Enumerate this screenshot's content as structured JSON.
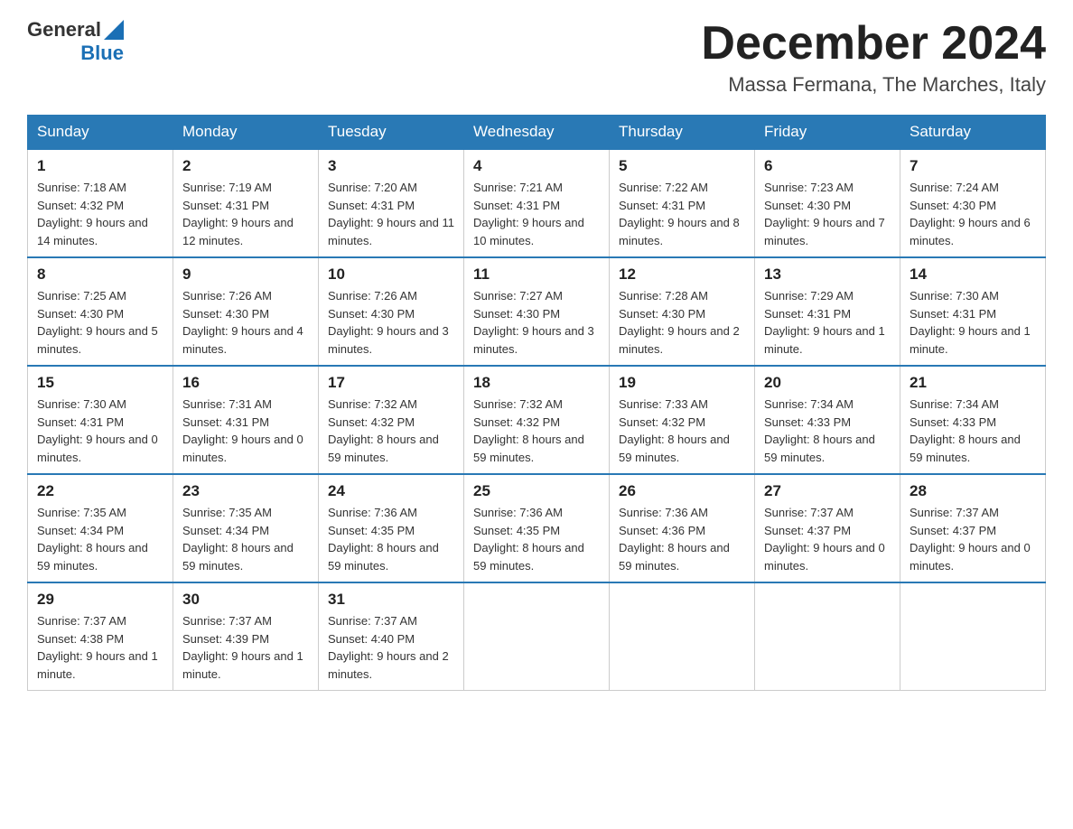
{
  "header": {
    "logo_general": "General",
    "logo_blue": "Blue",
    "title": "December 2024",
    "subtitle": "Massa Fermana, The Marches, Italy"
  },
  "calendar": {
    "days_of_week": [
      "Sunday",
      "Monday",
      "Tuesday",
      "Wednesday",
      "Thursday",
      "Friday",
      "Saturday"
    ],
    "weeks": [
      [
        {
          "day": "1",
          "sunrise": "7:18 AM",
          "sunset": "4:32 PM",
          "daylight": "9 hours and 14 minutes."
        },
        {
          "day": "2",
          "sunrise": "7:19 AM",
          "sunset": "4:31 PM",
          "daylight": "9 hours and 12 minutes."
        },
        {
          "day": "3",
          "sunrise": "7:20 AM",
          "sunset": "4:31 PM",
          "daylight": "9 hours and 11 minutes."
        },
        {
          "day": "4",
          "sunrise": "7:21 AM",
          "sunset": "4:31 PM",
          "daylight": "9 hours and 10 minutes."
        },
        {
          "day": "5",
          "sunrise": "7:22 AM",
          "sunset": "4:31 PM",
          "daylight": "9 hours and 8 minutes."
        },
        {
          "day": "6",
          "sunrise": "7:23 AM",
          "sunset": "4:30 PM",
          "daylight": "9 hours and 7 minutes."
        },
        {
          "day": "7",
          "sunrise": "7:24 AM",
          "sunset": "4:30 PM",
          "daylight": "9 hours and 6 minutes."
        }
      ],
      [
        {
          "day": "8",
          "sunrise": "7:25 AM",
          "sunset": "4:30 PM",
          "daylight": "9 hours and 5 minutes."
        },
        {
          "day": "9",
          "sunrise": "7:26 AM",
          "sunset": "4:30 PM",
          "daylight": "9 hours and 4 minutes."
        },
        {
          "day": "10",
          "sunrise": "7:26 AM",
          "sunset": "4:30 PM",
          "daylight": "9 hours and 3 minutes."
        },
        {
          "day": "11",
          "sunrise": "7:27 AM",
          "sunset": "4:30 PM",
          "daylight": "9 hours and 3 minutes."
        },
        {
          "day": "12",
          "sunrise": "7:28 AM",
          "sunset": "4:30 PM",
          "daylight": "9 hours and 2 minutes."
        },
        {
          "day": "13",
          "sunrise": "7:29 AM",
          "sunset": "4:31 PM",
          "daylight": "9 hours and 1 minute."
        },
        {
          "day": "14",
          "sunrise": "7:30 AM",
          "sunset": "4:31 PM",
          "daylight": "9 hours and 1 minute."
        }
      ],
      [
        {
          "day": "15",
          "sunrise": "7:30 AM",
          "sunset": "4:31 PM",
          "daylight": "9 hours and 0 minutes."
        },
        {
          "day": "16",
          "sunrise": "7:31 AM",
          "sunset": "4:31 PM",
          "daylight": "9 hours and 0 minutes."
        },
        {
          "day": "17",
          "sunrise": "7:32 AM",
          "sunset": "4:32 PM",
          "daylight": "8 hours and 59 minutes."
        },
        {
          "day": "18",
          "sunrise": "7:32 AM",
          "sunset": "4:32 PM",
          "daylight": "8 hours and 59 minutes."
        },
        {
          "day": "19",
          "sunrise": "7:33 AM",
          "sunset": "4:32 PM",
          "daylight": "8 hours and 59 minutes."
        },
        {
          "day": "20",
          "sunrise": "7:34 AM",
          "sunset": "4:33 PM",
          "daylight": "8 hours and 59 minutes."
        },
        {
          "day": "21",
          "sunrise": "7:34 AM",
          "sunset": "4:33 PM",
          "daylight": "8 hours and 59 minutes."
        }
      ],
      [
        {
          "day": "22",
          "sunrise": "7:35 AM",
          "sunset": "4:34 PM",
          "daylight": "8 hours and 59 minutes."
        },
        {
          "day": "23",
          "sunrise": "7:35 AM",
          "sunset": "4:34 PM",
          "daylight": "8 hours and 59 minutes."
        },
        {
          "day": "24",
          "sunrise": "7:36 AM",
          "sunset": "4:35 PM",
          "daylight": "8 hours and 59 minutes."
        },
        {
          "day": "25",
          "sunrise": "7:36 AM",
          "sunset": "4:35 PM",
          "daylight": "8 hours and 59 minutes."
        },
        {
          "day": "26",
          "sunrise": "7:36 AM",
          "sunset": "4:36 PM",
          "daylight": "8 hours and 59 minutes."
        },
        {
          "day": "27",
          "sunrise": "7:37 AM",
          "sunset": "4:37 PM",
          "daylight": "9 hours and 0 minutes."
        },
        {
          "day": "28",
          "sunrise": "7:37 AM",
          "sunset": "4:37 PM",
          "daylight": "9 hours and 0 minutes."
        }
      ],
      [
        {
          "day": "29",
          "sunrise": "7:37 AM",
          "sunset": "4:38 PM",
          "daylight": "9 hours and 1 minute."
        },
        {
          "day": "30",
          "sunrise": "7:37 AM",
          "sunset": "4:39 PM",
          "daylight": "9 hours and 1 minute."
        },
        {
          "day": "31",
          "sunrise": "7:37 AM",
          "sunset": "4:40 PM",
          "daylight": "9 hours and 2 minutes."
        },
        null,
        null,
        null,
        null
      ]
    ]
  }
}
